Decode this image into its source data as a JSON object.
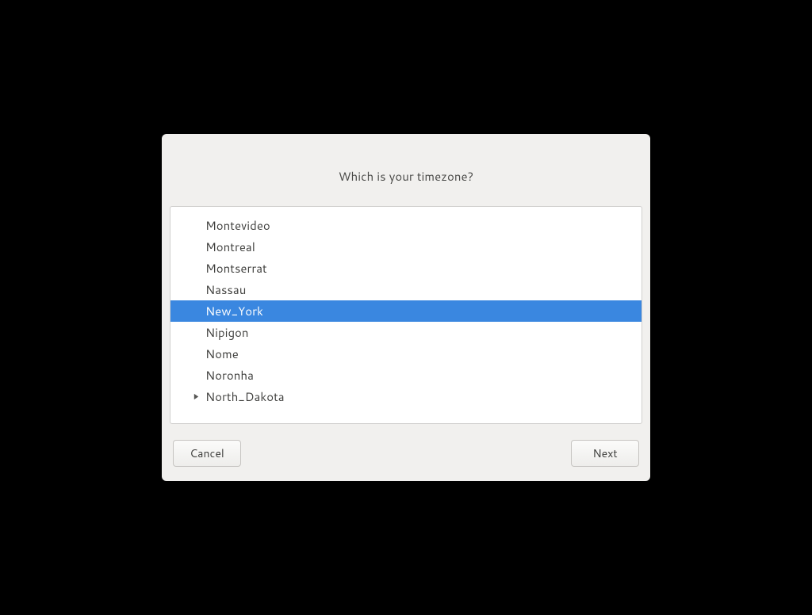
{
  "dialog": {
    "title": "Which is your timezone?",
    "buttons": {
      "cancel": "Cancel",
      "next": "Next"
    }
  },
  "timezone_list": {
    "selected_index": 4,
    "items": [
      {
        "label": "Montevideo",
        "expandable": false
      },
      {
        "label": "Montreal",
        "expandable": false
      },
      {
        "label": "Montserrat",
        "expandable": false
      },
      {
        "label": "Nassau",
        "expandable": false
      },
      {
        "label": "New_York",
        "expandable": false
      },
      {
        "label": "Nipigon",
        "expandable": false
      },
      {
        "label": "Nome",
        "expandable": false
      },
      {
        "label": "Noronha",
        "expandable": false
      },
      {
        "label": "North_Dakota",
        "expandable": true
      }
    ]
  }
}
